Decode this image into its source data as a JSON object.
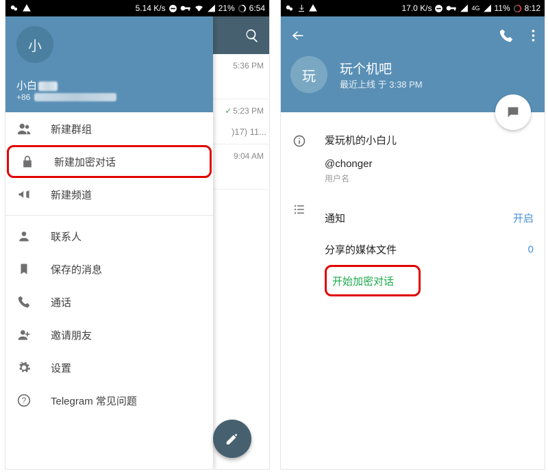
{
  "left": {
    "status": {
      "speed": "5.14 K/s",
      "battery": "21%",
      "time": "6:54"
    },
    "drawer": {
      "avatar_letter": "小",
      "name": "小白",
      "phone_prefix": "+86",
      "items": [
        {
          "label": "新建群组"
        },
        {
          "label": "新建加密对话"
        },
        {
          "label": "新建频道"
        },
        {
          "label": "联系人"
        },
        {
          "label": "保存的消息"
        },
        {
          "label": "通话"
        },
        {
          "label": "邀请朋友"
        },
        {
          "label": "设置"
        },
        {
          "label": "Telegram 常见问题"
        }
      ]
    },
    "chats": [
      {
        "time": "5:36 PM",
        "sub": ""
      },
      {
        "time": "5:23 PM",
        "sub": ")17) 11..."
      },
      {
        "time": "9:04 AM",
        "sub": ""
      }
    ]
  },
  "right": {
    "status": {
      "speed": "17.0 K/s",
      "net": "4G",
      "battery": "11%",
      "time": "8:12"
    },
    "profile": {
      "avatar_letter": "玩",
      "name": "玩个机吧",
      "last_seen": "最近上线 于 3:38 PM",
      "bio": "爱玩机的小白儿",
      "username": "@chonger",
      "username_label": "用户名",
      "notifications_label": "通知",
      "notifications_value": "开启",
      "shared_label": "分享的媒体文件",
      "shared_value": "0",
      "start_secret": "开始加密对话"
    }
  }
}
